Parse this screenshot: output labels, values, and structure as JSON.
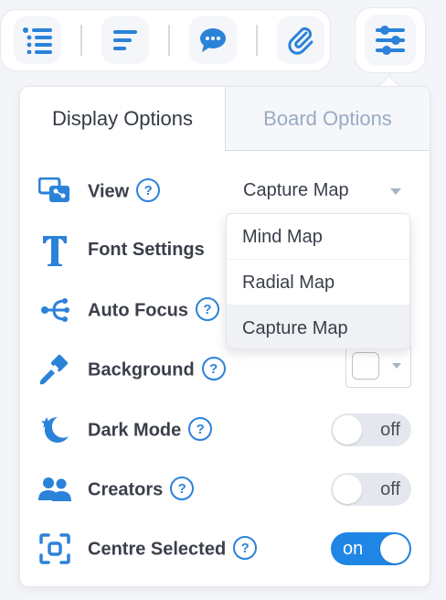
{
  "toolbar": {
    "buttons": [
      {
        "icon": "list-icon"
      },
      {
        "icon": "text-lines-icon"
      },
      {
        "icon": "comment-icon"
      },
      {
        "icon": "attachment-icon"
      }
    ],
    "settings_icon": "sliders-icon"
  },
  "tabs": {
    "display": "Display Options",
    "board": "Board Options"
  },
  "help_glyph": "?",
  "options": {
    "view": {
      "label": "View",
      "value": "Capture Map"
    },
    "font_settings": {
      "label": "Font Settings"
    },
    "auto_focus": {
      "label": "Auto Focus"
    },
    "background": {
      "label": "Background",
      "color": "#ffffff"
    },
    "dark_mode": {
      "label": "Dark Mode",
      "state": "off"
    },
    "creators": {
      "label": "Creators",
      "state": "off"
    },
    "centre_selected": {
      "label": "Centre Selected",
      "state": "on"
    }
  },
  "view_menu": {
    "items": [
      "Mind Map",
      "Radial Map",
      "Capture Map"
    ],
    "selected": "Capture Map"
  },
  "colors": {
    "accent": "#1f86e6",
    "icon": "#2b82d9",
    "toggle_off": "#e4e8ee"
  }
}
